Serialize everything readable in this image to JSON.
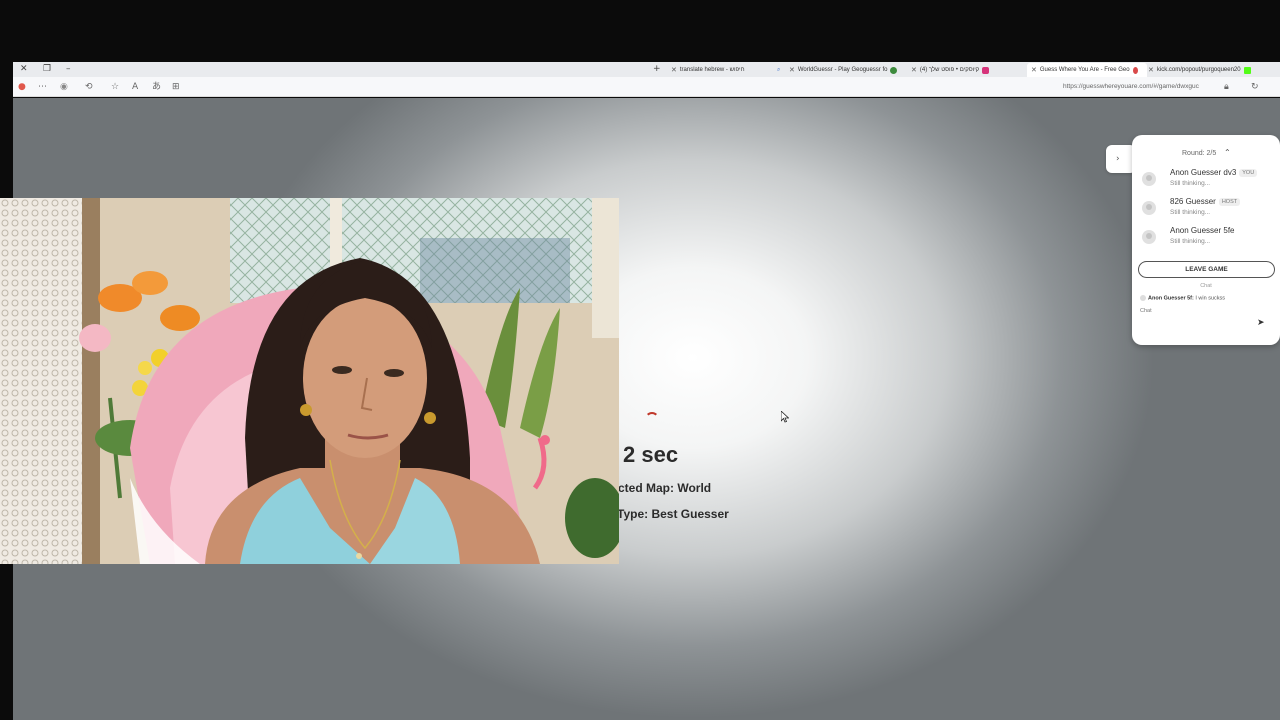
{
  "browser": {
    "tabs": [
      {
        "title": "translate hebrew - חיפוש",
        "active": false
      },
      {
        "title": "WorldGuessr - Play Geoguessr fo",
        "active": false
      },
      {
        "title": "קיוסקים • פוסט שלך (4)",
        "active": false
      },
      {
        "title": "Guess Where You Are - Free Geo",
        "active": true
      },
      {
        "title": "kick.com/popout/purgoqueen20",
        "active": false
      }
    ],
    "url": "https://guesswhereyouare.com/#/game/dwxguc"
  },
  "game": {
    "timer": "2 sec",
    "selected_map": "cted Map: World",
    "game_type": "Type: Best Guesser"
  },
  "panel": {
    "round": "Round: 2/5",
    "players": [
      {
        "name": "Anon Guesser dv3",
        "badge": "YOU",
        "status": "Still thinking..."
      },
      {
        "name": "826 Guesser",
        "badge": "HOST",
        "status": "Still thinking..."
      },
      {
        "name": "Anon Guesser 5fe",
        "badge": "",
        "status": "Still thinking..."
      }
    ],
    "leave_label": "LEAVE GAME",
    "chat_title": "Chat",
    "chat_message": {
      "author": "Anon Guesser 5f:",
      "text": " I win suckss"
    },
    "chat_placeholder": "Chat"
  },
  "colors": {
    "spinner": "#c0392b",
    "chair_pink": "#f0a8bb",
    "top_blue": "#8fd0dc"
  }
}
